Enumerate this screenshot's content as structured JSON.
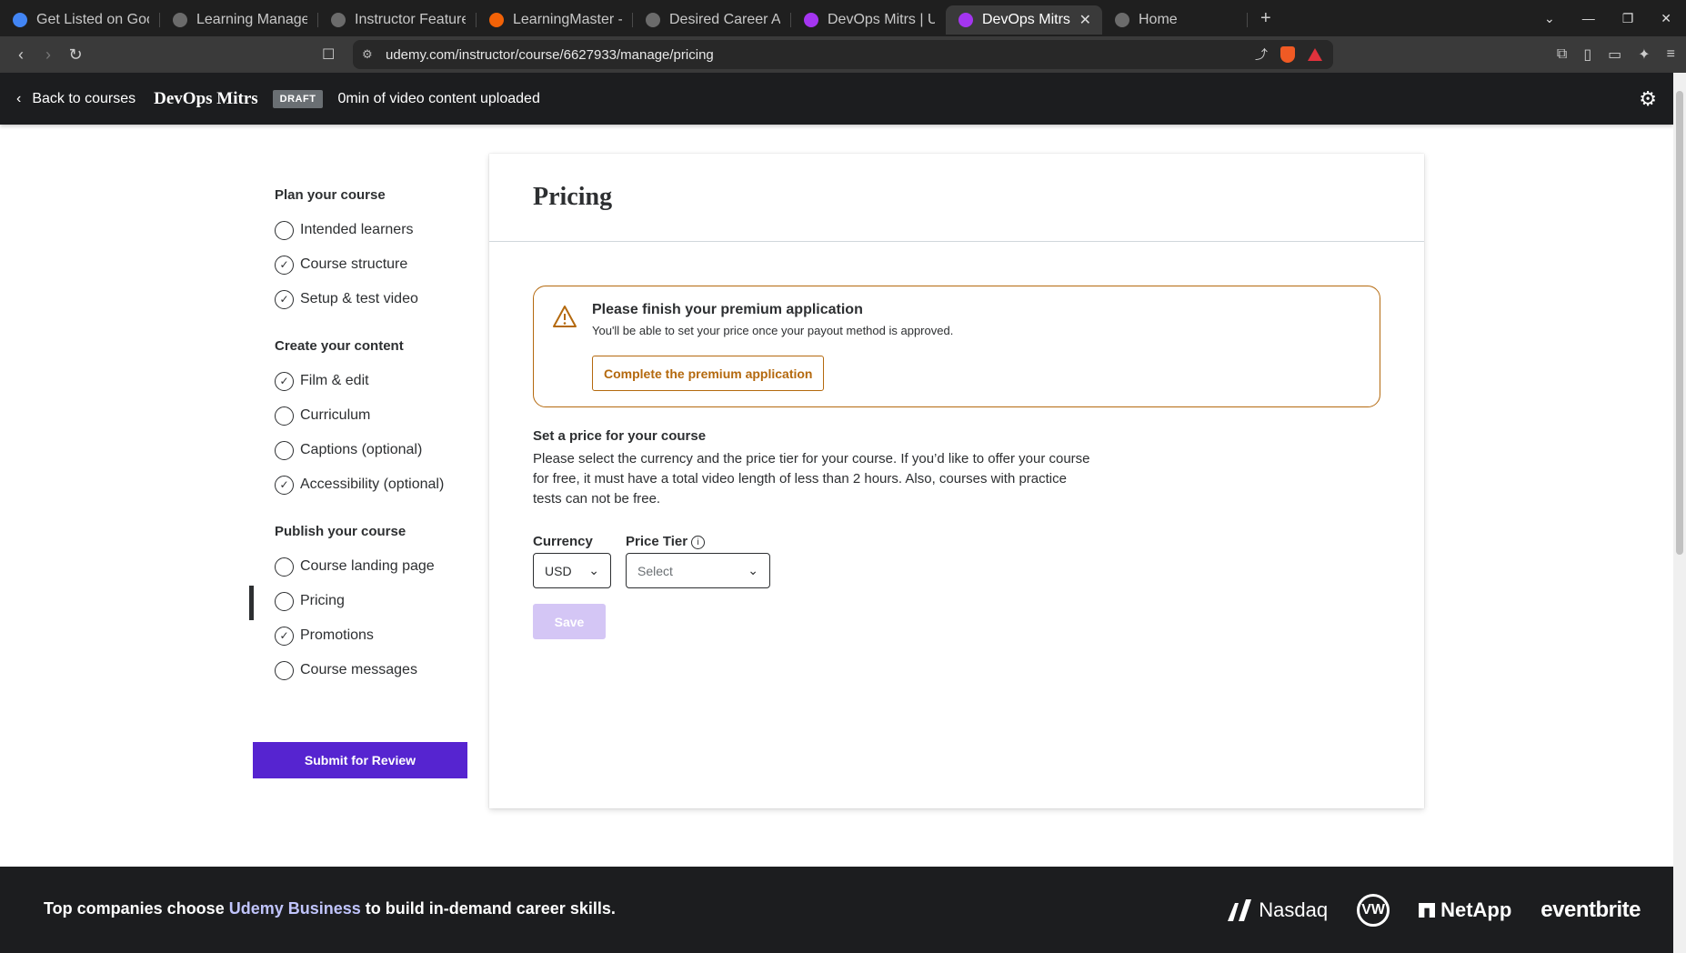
{
  "browser": {
    "tabs": [
      {
        "title": "Get Listed on Google -",
        "icon": "google-icon",
        "color": "#4285f4"
      },
      {
        "title": "Learning Management",
        "icon": "openai-icon",
        "color": "#6b6b6b"
      },
      {
        "title": "Instructor Features Cor",
        "icon": "openai-icon",
        "color": "#6b6b6b"
      },
      {
        "title": "LearningMaster - Replit",
        "icon": "replit-icon",
        "color": "#f26207"
      },
      {
        "title": "Desired Career Academ",
        "icon": "globe-icon",
        "color": "#6b6b6b"
      },
      {
        "title": "DevOps Mitrs | Udemy",
        "icon": "udemy-icon",
        "color": "#a435f0"
      },
      {
        "title": "DevOps Mitrs | Udem",
        "icon": "udemy-icon",
        "color": "#a435f0"
      },
      {
        "title": "Home",
        "icon": "info-icon",
        "color": "#6b6b6b"
      }
    ],
    "url": "udemy.com/instructor/course/6627933/manage/pricing"
  },
  "header": {
    "back_label": "Back to courses",
    "course_title": "DevOps Mitrs",
    "status_badge": "DRAFT",
    "upload_status": "0min of video content uploaded"
  },
  "sidebar": {
    "groups": [
      {
        "title": "Plan your course",
        "items": [
          {
            "label": "Intended learners",
            "checked": false
          },
          {
            "label": "Course structure",
            "checked": true
          },
          {
            "label": "Setup & test video",
            "checked": true
          }
        ]
      },
      {
        "title": "Create your content",
        "items": [
          {
            "label": "Film & edit",
            "checked": true
          },
          {
            "label": "Curriculum",
            "checked": false
          },
          {
            "label": "Captions (optional)",
            "checked": false
          },
          {
            "label": "Accessibility (optional)",
            "checked": true
          }
        ]
      },
      {
        "title": "Publish your course",
        "items": [
          {
            "label": "Course landing page",
            "checked": false
          },
          {
            "label": "Pricing",
            "checked": false,
            "active": true
          },
          {
            "label": "Promotions",
            "checked": true
          },
          {
            "label": "Course messages",
            "checked": false
          }
        ]
      }
    ],
    "submit_label": "Submit for Review"
  },
  "main": {
    "title": "Pricing",
    "alert": {
      "title": "Please finish your premium application",
      "description": "You'll be able to set your price once your payout method is approved.",
      "button_label": "Complete the premium application"
    },
    "section_title": "Set a price for your course",
    "section_description": "Please select the currency and the price tier for your course. If you’d like to offer your course for free, it must have a total video length of less than 2 hours. Also, courses with practice tests can not be free.",
    "currency_label": "Currency",
    "currency_value": "USD",
    "price_tier_label": "Price Tier",
    "price_tier_placeholder": "Select",
    "save_label": "Save"
  },
  "footer": {
    "tagline_before": "Top companies choose ",
    "tagline_highlight": "Udemy Business",
    "tagline_after": " to build in-demand career skills.",
    "logos": [
      "Nasdaq",
      "VW",
      "NetApp",
      "eventbrite"
    ]
  },
  "colors": {
    "accent": "#5624d0",
    "warning": "#b4690e",
    "dark": "#1c1d1f",
    "highlight": "#c0c4fc"
  }
}
